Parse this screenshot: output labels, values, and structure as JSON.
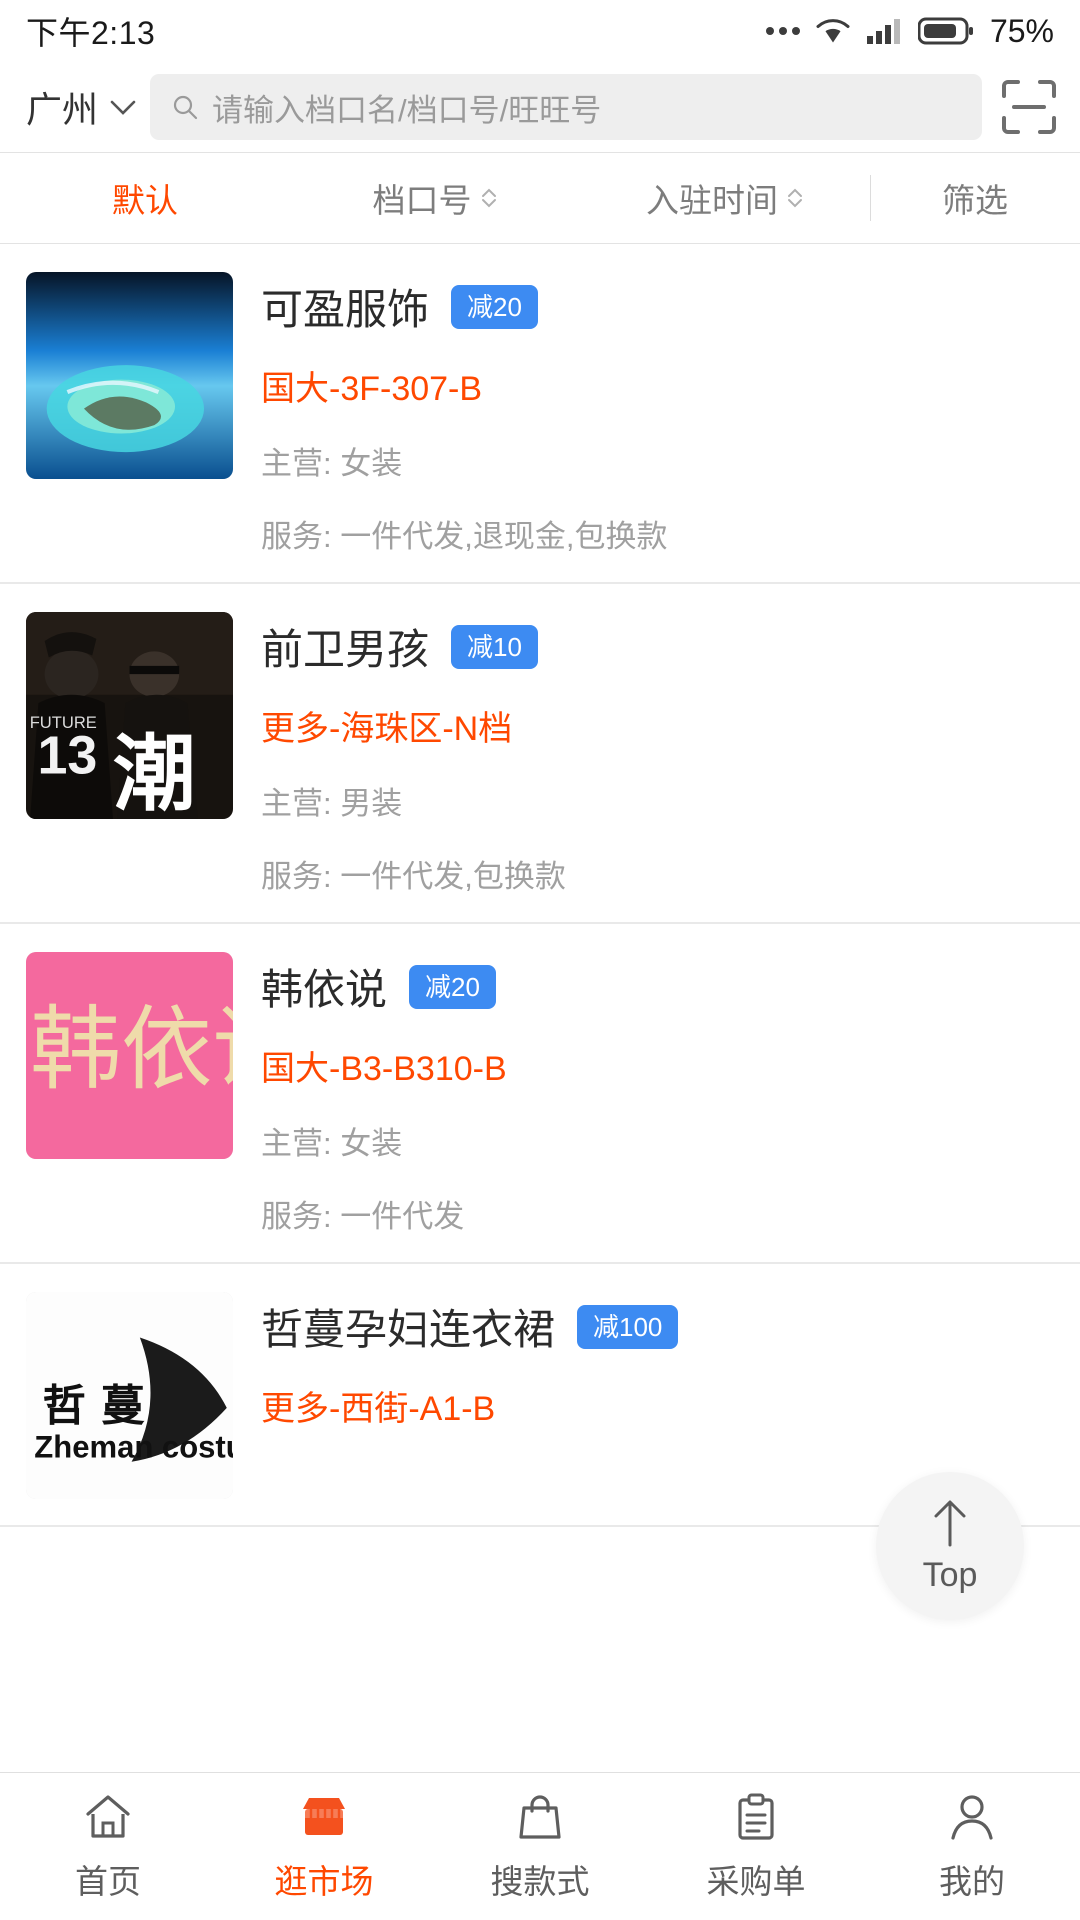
{
  "status_bar": {
    "time": "下午2:13",
    "battery_percent": "75%",
    "icons": [
      "more-dots-icon",
      "wifi-icon",
      "cellular-signal-icon",
      "battery-icon"
    ]
  },
  "header": {
    "city": "广州",
    "city_chevron": "chevron-down-icon",
    "search": {
      "icon": "search-icon",
      "placeholder": "请输入档口名/档口号/旺旺号",
      "value": ""
    },
    "scan_icon": "scan-qr-icon"
  },
  "filter_bar": {
    "items": [
      {
        "label": "默认",
        "active": true,
        "sortable": false
      },
      {
        "label": "档口号",
        "active": false,
        "sortable": true
      },
      {
        "label": "入驻时间",
        "active": false,
        "sortable": true
      },
      {
        "label": "筛选",
        "active": false,
        "sortable": false
      }
    ]
  },
  "shops": [
    {
      "name": "可盈服饰",
      "badge": "减20",
      "address": "国大-3F-307-B",
      "category": "主营: 女装",
      "services": "服务: 一件代发,退现金,包换款",
      "thumb": "aerial-island-ocean-photo"
    },
    {
      "name": "前卫男孩",
      "badge": "减10",
      "address": "更多-海珠区-N档",
      "category": "主营: 男装",
      "services": "服务: 一件代发,包换款",
      "thumb": "dark-streetwear-photo"
    },
    {
      "name": "韩依说",
      "badge": "减20",
      "address": "国大-B3-B310-B",
      "category": "主营: 女装",
      "services": "服务: 一件代发",
      "thumb": "pink-logo-photo"
    },
    {
      "name": "哲蔓孕妇连衣裙",
      "badge": "减100",
      "address": "更多-西街-A1-B",
      "category": "",
      "services": "",
      "thumb": "zheman-costume-logo"
    }
  ],
  "scroll_top_button": {
    "label": "Top",
    "icon": "arrow-up-icon"
  },
  "tab_bar": {
    "items": [
      {
        "label": "首页",
        "icon": "home-icon",
        "active": false
      },
      {
        "label": "逛市场",
        "icon": "shop-icon",
        "active": true
      },
      {
        "label": "搜款式",
        "icon": "bag-icon",
        "active": false
      },
      {
        "label": "采购单",
        "icon": "clipboard-icon",
        "active": false
      },
      {
        "label": "我的",
        "icon": "user-icon",
        "active": false
      }
    ]
  },
  "colors": {
    "accent_orange": "#ff4800",
    "badge_blue": "#3d8bf2",
    "muted_gray": "#a0a0a0"
  }
}
